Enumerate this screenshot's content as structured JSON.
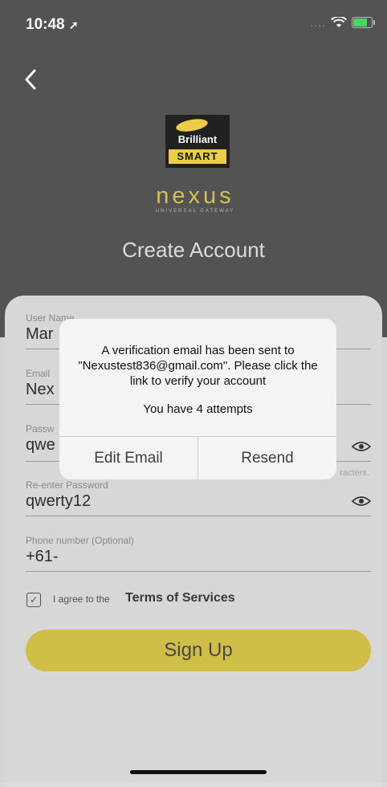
{
  "status_bar": {
    "time": "10:48",
    "signal": "....",
    "colors": {
      "battery": "#4cd964"
    }
  },
  "header": {
    "logo_top": "Brilliant",
    "logo_bottom": "SMART",
    "product": "nexus",
    "product_subtitle": "UNIVERSAL GATEWAY",
    "title": "Create Account"
  },
  "form": {
    "username": {
      "label": "User Name",
      "value": "Mar"
    },
    "email": {
      "label": "Email",
      "value": "Nex"
    },
    "password": {
      "label": "Passw",
      "value": "qwe",
      "hint": "racters."
    },
    "reenter_password": {
      "label": "Re-enter Password",
      "value": "qwerty12"
    },
    "phone": {
      "label": "Phone number (Optional)",
      "value": "+61-"
    },
    "agree_prefix": "I agree to the",
    "terms_link": "Terms of Services",
    "checkbox_checked": true,
    "signup_label": "Sign Up"
  },
  "dialog": {
    "message": "A verification email has been sent to \"Nexustest836@gmail.com\". Please click the link to verify your account",
    "attempts": "You have 4 attempts",
    "edit_label": "Edit Email",
    "resend_label": "Resend"
  },
  "colors": {
    "accent": "#d4c24a",
    "hero": "#555555",
    "card": "#dcdcdc"
  }
}
